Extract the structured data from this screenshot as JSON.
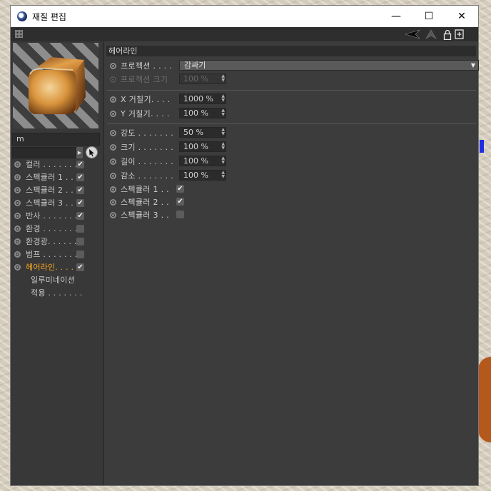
{
  "window": {
    "title": "재질 편집",
    "minimize": "—",
    "maximize": "☐",
    "close": "✕"
  },
  "left": {
    "material_name": "m",
    "channels": [
      {
        "label": "컬러 . . . . . . .",
        "checked": true
      },
      {
        "label": "스펙큘러 1 . .",
        "checked": true
      },
      {
        "label": "스펙큘러 2 . .",
        "checked": true
      },
      {
        "label": "스펙큘러 3 . .",
        "checked": true
      },
      {
        "label": "반사 . . . . . . .",
        "checked": true
      },
      {
        "label": "환경 . . . . . . .",
        "checked": false
      },
      {
        "label": "환경광. . . . . .",
        "checked": false
      },
      {
        "label": "범프 . . . . . . .",
        "checked": false
      },
      {
        "label": "헤어라인. . . .",
        "checked": true,
        "active": true
      }
    ],
    "extra": [
      "일루미네이션",
      "적용 . . . . . . ."
    ]
  },
  "right": {
    "section_title": "헤어라인",
    "projection_label": "프로젝션 . . . .",
    "projection_value": "감싸기",
    "projection_size_label": "프로젝션 크기",
    "projection_size_value": "100 %",
    "x_roughness_label": "X 거칠기. . . .",
    "x_roughness_value": "1000 %",
    "y_roughness_label": "Y 거칠기. . . .",
    "y_roughness_value": "100 %",
    "strength_label": "강도 . . . . . . .",
    "strength_value": "50 %",
    "size_label": "크기 . . . . . . .",
    "size_value": "100 %",
    "length_label": "길이 . . . . . . .",
    "length_value": "100 %",
    "attenuation_label": "감소 . . . . . . .",
    "attenuation_value": "100 %",
    "spec1_label": "스펙큘러 1 . .",
    "spec1_checked": true,
    "spec2_label": "스펙큘러 2 . .",
    "spec2_checked": true,
    "spec3_label": "스펙큘러 3 . .",
    "spec3_checked": false
  },
  "colors": {
    "active_channel": "#f5a623",
    "panel_bg": "#3c3c3c"
  }
}
